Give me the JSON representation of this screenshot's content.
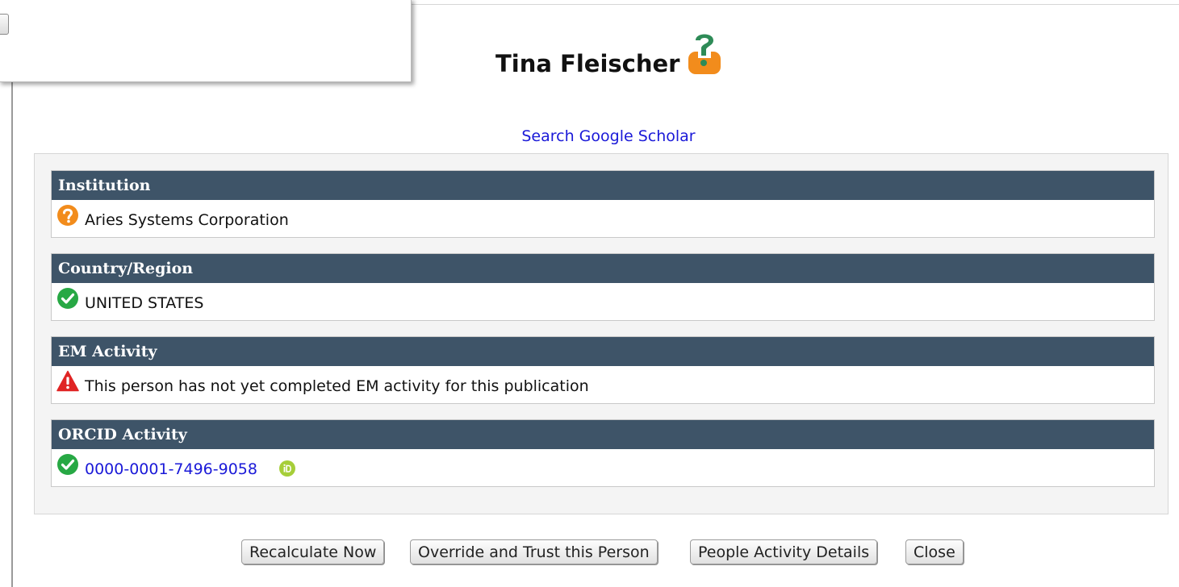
{
  "person": {
    "name": "Tina Fleischer",
    "status_icon": "unknown-person-icon"
  },
  "links": {
    "google_scholar": "Search Google Scholar"
  },
  "sections": [
    {
      "title": "Institution",
      "status": "unknown",
      "status_icon": "question-circle-icon",
      "text": "Aries Systems Corporation"
    },
    {
      "title": "Country/Region",
      "status": "verified",
      "status_icon": "check-circle-icon",
      "text": "UNITED STATES"
    },
    {
      "title": "EM Activity",
      "status": "warning",
      "status_icon": "warning-triangle-icon",
      "text": "This person has not yet completed EM activity for this publication"
    },
    {
      "title": "ORCID Activity",
      "status": "verified",
      "status_icon": "check-circle-icon",
      "text": "0000-0001-7496-9058",
      "badge_icon": "orcid-icon"
    }
  ],
  "buttons": {
    "recalculate": "Recalculate Now",
    "override": "Override and Trust this Person",
    "activity_details": "People Activity Details",
    "close": "Close"
  },
  "colors": {
    "section_header_bg": "#3e5468",
    "link": "#1a19d8",
    "unknown": "#f28c1c",
    "verified": "#27a844",
    "warning": "#e02424",
    "orcid": "#a6ce39"
  }
}
